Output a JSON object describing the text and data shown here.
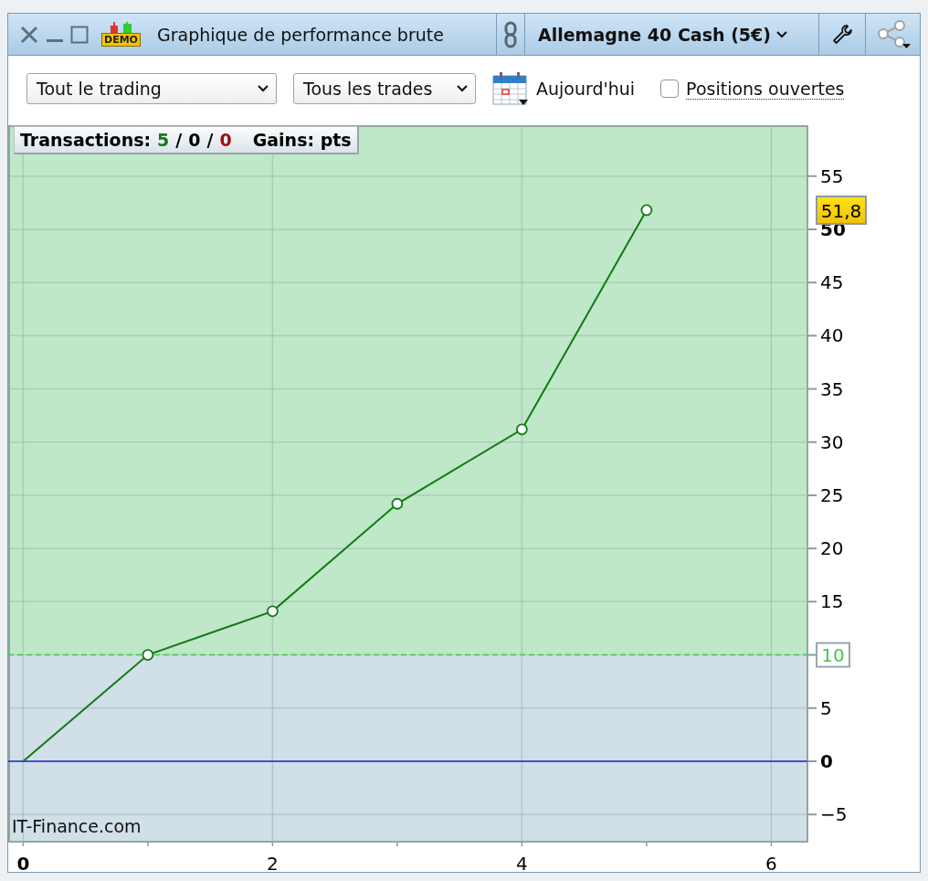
{
  "window": {
    "title": "Graphique de performance brute",
    "badge": "DEMO",
    "instrument": "Allemagne 40 Cash (5€)"
  },
  "toolbar": {
    "scope_select": {
      "value": "Tout le trading"
    },
    "trades_select": {
      "value": "Tous les trades"
    },
    "date_label": "Aujourd'hui",
    "open_positions": {
      "label": "Positions ouvertes",
      "checked": false
    }
  },
  "chart": {
    "legend": {
      "label": "Transactions:",
      "counts": [
        {
          "text": "5",
          "color": "#167a16"
        },
        {
          "text": "/",
          "color": "#000000"
        },
        {
          "text": "0",
          "color": "#000000"
        },
        {
          "text": "/",
          "color": "#000000"
        },
        {
          "text": "0",
          "color": "#a01010"
        }
      ],
      "gains": "Gains: pts"
    },
    "watermark": "IT-Finance.com",
    "chart_data": {
      "type": "line",
      "x": [
        0,
        1,
        2,
        3,
        4,
        5
      ],
      "series": [
        {
          "color": "#137a13",
          "marker": "o",
          "values": [
            0,
            10,
            14.1,
            24.2,
            31.2,
            51.8
          ]
        }
      ],
      "grid": true,
      "xlim": [
        -0.12,
        6.29
      ],
      "ylim": [
        -7.56,
        59.7
      ],
      "xticks": [
        0,
        2,
        4,
        6
      ],
      "yticks": [
        {
          "value": -5,
          "label": "−5"
        },
        0,
        5,
        10,
        15,
        20,
        25,
        30,
        35,
        40,
        45,
        50,
        55
      ],
      "annotations": [
        {
          "text": "51,8"
        }
      ],
      "ref_lines": [
        {
          "axis": "y",
          "value": 10,
          "label": "10",
          "color": "#45c84f"
        },
        {
          "axis": "y",
          "value": 0,
          "color": "#2222dd"
        }
      ],
      "bands": [
        {
          "axis": "y",
          "from": 10,
          "to": 59.7,
          "color": "#bee8c8"
        },
        {
          "axis": "y",
          "from": -7.56,
          "to": 10,
          "color": "#d0dfe8"
        }
      ]
    }
  }
}
